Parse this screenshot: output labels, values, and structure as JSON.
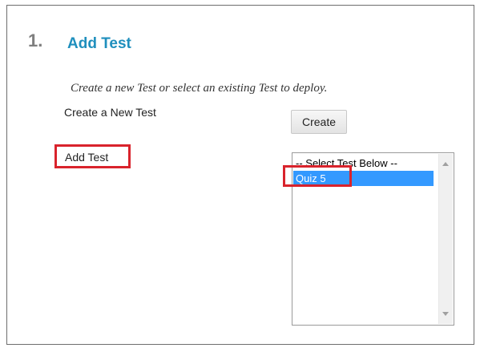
{
  "step": {
    "number": "1.",
    "title": "Add Test"
  },
  "instructions": "Create a new Test or select an existing Test to deploy.",
  "create_row": {
    "label": "Create a New Test",
    "button_label": "Create"
  },
  "add_row": {
    "label": "Add Test",
    "listbox": {
      "options": [
        "-- Select Test Below --",
        "Quiz 5"
      ],
      "selected": "Quiz 5"
    }
  },
  "colors": {
    "title": "#1f8fbd",
    "highlight": "#d9232c",
    "selection": "#3399ff"
  }
}
